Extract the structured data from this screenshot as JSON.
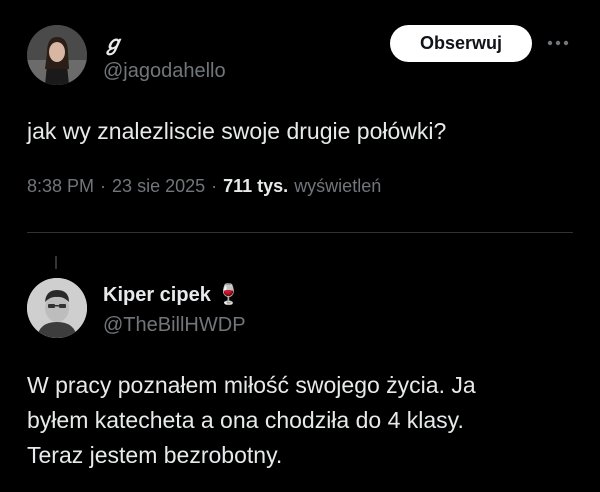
{
  "tweet": {
    "author_name": "ℊ",
    "author_handle": "@jagodahello",
    "follow_label": "Obserwuj",
    "more_label": "···",
    "text": "jak wy znalezliscie swoje drugie połówki?",
    "time": "8:38 PM",
    "date": "23 sie 2025",
    "separator": "·",
    "views_count": "711 tys.",
    "views_label": "wyświetleń"
  },
  "reply": {
    "author_name": "Kiper cipek",
    "author_emoji": "🍷",
    "author_handle": "@TheBillHWDP",
    "lines": [
      "W pracy poznałem miłość swojego życia. Ja",
      "byłem katecheta a ona chodziła do 4 klasy.",
      "Teraz jestem bezrobotny."
    ]
  },
  "colors": {
    "background": "#000000",
    "text": "#e7e9ea",
    "secondary": "#71767b",
    "button_bg": "#ffffff",
    "divider": "#2f3336"
  }
}
